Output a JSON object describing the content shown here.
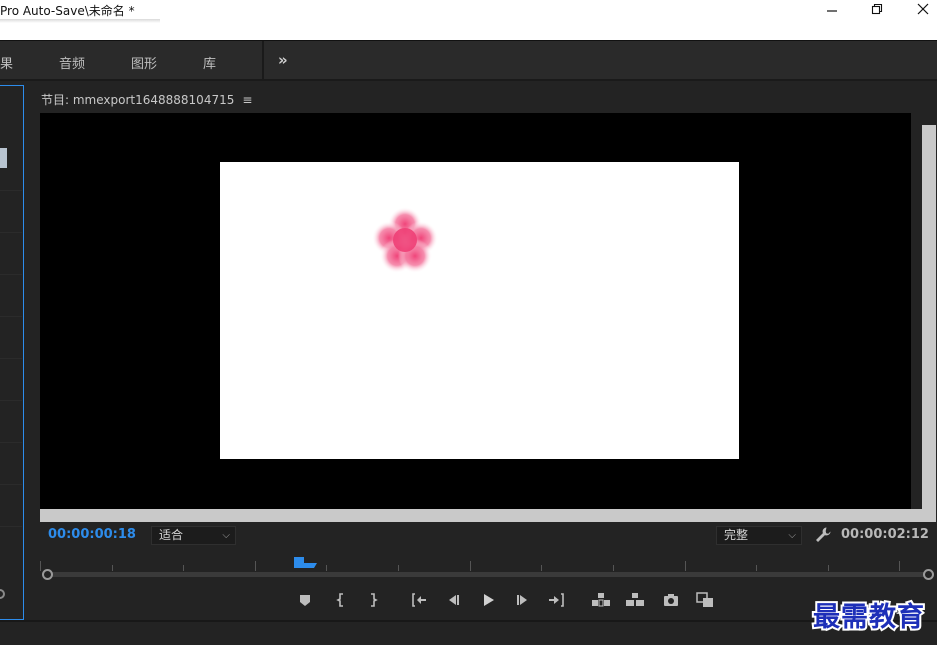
{
  "window": {
    "title": "Pro Auto-Save\\未命名 *",
    "buttons": [
      "minimize",
      "restore",
      "close"
    ]
  },
  "workspace_tabs": [
    "果",
    "音频",
    "图形",
    "库"
  ],
  "workspace_more": "»",
  "program_monitor": {
    "title": "节目: mmexport1648888104715",
    "menu_icon": "≡",
    "current_timecode": "00:00:00:18",
    "duration_timecode": "00:00:02:12",
    "zoom_select": "适合",
    "resolution_select": "完整",
    "playhead_fraction": 0.29,
    "colors": {
      "timecode_current": "#2d8ceb",
      "timecode_duration": "#b8b8b8",
      "playhead": "#2d8ceb",
      "flower": "#f0457a"
    },
    "transport_icons": [
      "add-marker-icon",
      "mark-in-icon",
      "mark-out-icon",
      "go-to-in-icon",
      "step-back-icon",
      "play-icon",
      "step-forward-icon",
      "go-to-out-icon",
      "lift-icon",
      "extract-icon",
      "export-frame-icon",
      "button-editor-icon"
    ]
  },
  "watermark": "最需教育"
}
